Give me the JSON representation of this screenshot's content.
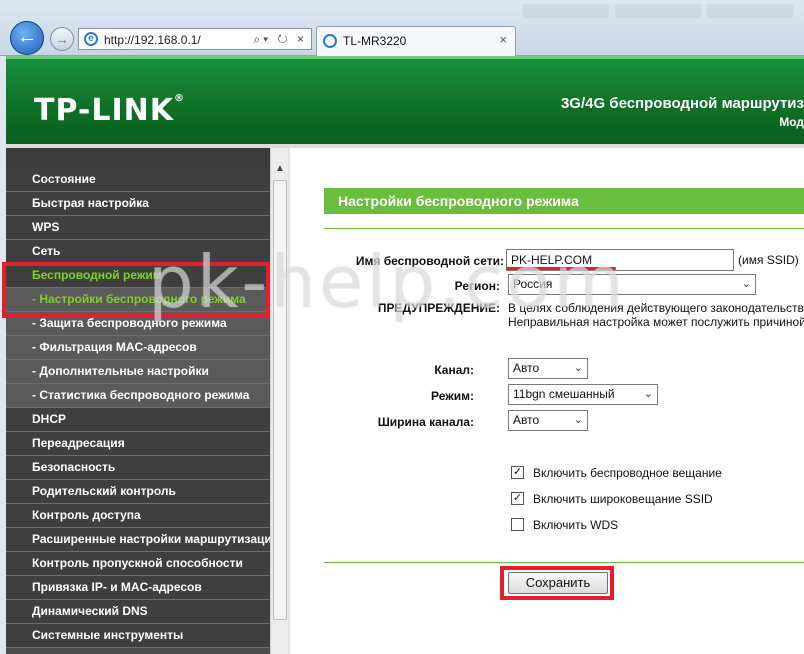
{
  "browser": {
    "url": "http://192.168.0.1/",
    "tab_title": "TL-MR3220",
    "back_glyph": "←",
    "forward_glyph": "→",
    "address_tools": "⌕▾ ↻ ×",
    "tab_close": "×"
  },
  "header": {
    "logo": "TP-LINK",
    "logo_reg": "®",
    "subtitle": "3G/4G беспроводной маршрутиз",
    "model_label": "Мод"
  },
  "sidebar": {
    "items": [
      {
        "label": "Состояние",
        "sub": false,
        "active": false
      },
      {
        "label": "Быстрая настройка",
        "sub": false,
        "active": false
      },
      {
        "label": "WPS",
        "sub": false,
        "active": false
      },
      {
        "label": "Сеть",
        "sub": false,
        "active": false
      },
      {
        "label": "Беспроводной режим",
        "sub": false,
        "active": true
      },
      {
        "label": "- Настройки беспроводного режима",
        "sub": true,
        "active": true
      },
      {
        "label": "- Защита беспроводного режима",
        "sub": true,
        "active": false
      },
      {
        "label": "- Фильтрация MAC-адресов",
        "sub": true,
        "active": false
      },
      {
        "label": "- Дополнительные настройки",
        "sub": true,
        "active": false
      },
      {
        "label": "- Статистика беспроводного режима",
        "sub": true,
        "active": false
      },
      {
        "label": "DHCP",
        "sub": false,
        "active": false
      },
      {
        "label": "Переадресация",
        "sub": false,
        "active": false
      },
      {
        "label": "Безопасность",
        "sub": false,
        "active": false
      },
      {
        "label": "Родительский контроль",
        "sub": false,
        "active": false
      },
      {
        "label": "Контроль доступа",
        "sub": false,
        "active": false
      },
      {
        "label": "Расширенные настройки маршрутизации",
        "sub": false,
        "active": false
      },
      {
        "label": "Контроль пропускной способности",
        "sub": false,
        "active": false
      },
      {
        "label": "Привязка IP- и MAC-адресов",
        "sub": false,
        "active": false
      },
      {
        "label": "Динамический DNS",
        "sub": false,
        "active": false
      },
      {
        "label": "Системные инструменты",
        "sub": false,
        "active": false
      }
    ]
  },
  "main": {
    "section_title": "Настройки беспроводного режима",
    "ssid_label": "Имя беспроводной сети:",
    "ssid_value": "PK-HELP.COM",
    "ssid_hint": "(имя SSID)",
    "region_label": "Регион:",
    "region_value": "Россия",
    "warning_label": "ПРЕДУПРЕЖДЕНИЕ:",
    "warning_line1": "В целях соблюдения действующего законодательства",
    "warning_line2": "Неправильная настройка может послужить причиной",
    "channel_label": "Канал:",
    "channel_value": "Авто",
    "mode_label": "Режим:",
    "mode_value": "11bgn смешанный",
    "width_label": "Ширина канала:",
    "width_value": "Авто",
    "cb_broadcast": {
      "label": "Включить беспроводное вещание",
      "checked": true
    },
    "cb_ssid": {
      "label": "Включить широковещание SSID",
      "checked": true
    },
    "cb_wds": {
      "label": "Включить WDS",
      "checked": false
    },
    "save_label": "Сохранить",
    "chevron_glyph": "⌄",
    "check_glyph": "✓"
  },
  "watermark": "pk-help.com",
  "colors": {
    "header_green": "#0e6f27",
    "accent_green": "#6bbd3d",
    "active_menu": "#7ccf2b",
    "annotation_red": "#e02030"
  }
}
